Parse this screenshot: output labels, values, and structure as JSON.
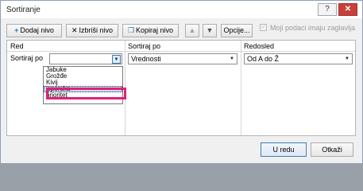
{
  "window": {
    "title": "Sortiranje",
    "help_label": "?",
    "close_label": "✕"
  },
  "toolbar": {
    "add_level": "Dodaj nivo",
    "delete_level": "Izbriši nivo",
    "copy_level": "Kopiraj nivo",
    "move_up_label": "▲",
    "move_down_label": "▼",
    "options": "Opcije...",
    "headers_checkbox": {
      "label": "Moji podaci imaju zaglavlja",
      "checked": true,
      "enabled": false
    },
    "add_icon": "plus-icon",
    "delete_icon": "x-icon",
    "copy_icon": "copy-icon"
  },
  "grid": {
    "headers": {
      "column": "Red",
      "sort_on": "Sortiraj po",
      "order": "Redosled"
    },
    "row": {
      "label": "Sortiraj po",
      "column_value": "",
      "sort_on_value": "Vrednosti",
      "order_value": "Od A do Ž"
    },
    "dropdown_options": [
      "Jabuke",
      "Grožđe",
      "Kivij",
      "isporuka",
      "prioritet"
    ],
    "selected_option": "isporuka"
  },
  "footer": {
    "ok_label": "U redu",
    "cancel_label": "Otkaži"
  },
  "colors": {
    "highlight_box": "#e0207a",
    "selected_item": "#c5dff7",
    "close_button": "#c7403b"
  }
}
